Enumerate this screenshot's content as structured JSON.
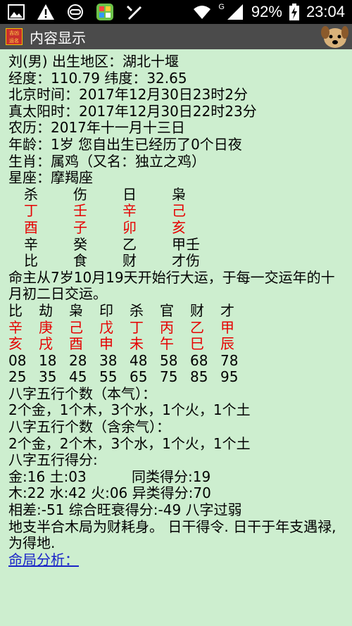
{
  "status_bar": {
    "signal_label": "G",
    "battery": "92%",
    "time": "23:04"
  },
  "app_bar": {
    "logo_text": "吉凶\n运名",
    "title": "内容显示"
  },
  "content": {
    "l1": "刘(男) 出生地区：湖北十堰",
    "l2": "经度：110.79 纬度：32.65",
    "l3": "北京时间：2017年12月30日23时2分",
    "l4": "真太阳时：2017年12月30日22时23分",
    "l5": "农历：2017年十一月十三日",
    "l6": "年龄：1岁 您自出生已经历了0个日夜",
    "l7": "生肖：属鸡（又名：独立之鸡）",
    "l8": "星座：摩羯座",
    "pillar_top": [
      "杀",
      "伤",
      "日",
      "枭"
    ],
    "pillar_gan": [
      "丁",
      "壬",
      "辛",
      "己"
    ],
    "pillar_zhi": [
      "酉",
      "子",
      "卯",
      "亥"
    ],
    "pillar_hidden": [
      "辛",
      "癸",
      "乙",
      "甲壬"
    ],
    "pillar_hidden_gods": [
      "比",
      "食",
      "财",
      "才伤"
    ],
    "luck_start": "命主从7岁10月19天开始行大运，于每一交运年的十月初二日交运。",
    "luck_gods": [
      "比",
      "劫",
      "枭",
      "印",
      "杀",
      "官",
      "财",
      "才"
    ],
    "luck_gan": [
      "辛",
      "庚",
      "己",
      "戊",
      "丁",
      "丙",
      "乙",
      "甲"
    ],
    "luck_zhi": [
      "亥",
      "戌",
      "酉",
      "申",
      "未",
      "午",
      "巳",
      "辰"
    ],
    "luck_ages": [
      "08",
      "18",
      "28",
      "38",
      "48",
      "58",
      "68",
      "78"
    ],
    "luck_years": [
      "25",
      "35",
      "45",
      "55",
      "65",
      "75",
      "85",
      "95"
    ],
    "count_main_label": "八字五行个数（本气）：",
    "count_main": "2个金，1个木，3个水，1个火，1个土",
    "count_all_label": "八字五行个数（含余气）：",
    "count_all": "2个金，2个木，3个水，1个火，1个土",
    "score_label": "八字五行得分:",
    "score_row1_left": "金:16 土:03",
    "score_row1_right": "同类得分:19",
    "score_row2": "木:22 水:42 火:06 异类得分:70",
    "diff_row": "相差:-51 综合旺衰得分:-49 八字过弱",
    "analysis_text": "地支半合木局为财耗身。 日干得令. 日干于年支遇禄, 为得地.",
    "section_link": "命局分析："
  },
  "colors": {
    "background": "#cdeecf",
    "highlight_red": "#e60000",
    "link_blue": "#1a24c8",
    "appbar": "#4b4b4b"
  }
}
